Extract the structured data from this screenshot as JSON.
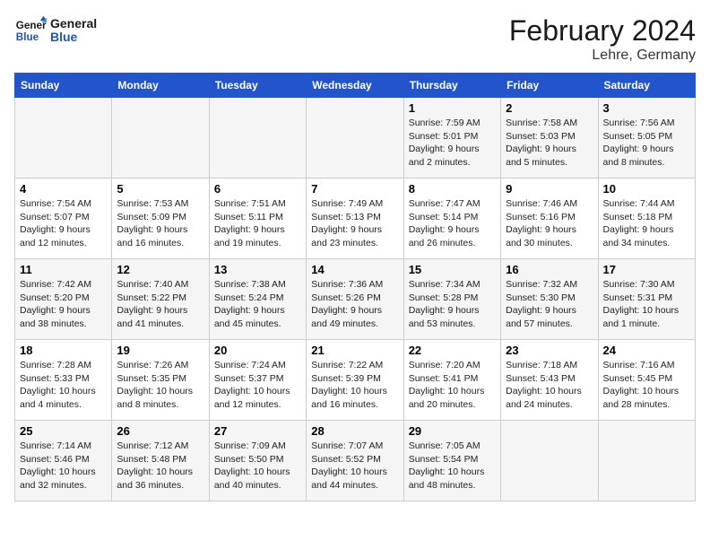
{
  "header": {
    "logo_general": "General",
    "logo_blue": "Blue",
    "title": "February 2024",
    "subtitle": "Lehre, Germany"
  },
  "weekdays": [
    "Sunday",
    "Monday",
    "Tuesday",
    "Wednesday",
    "Thursday",
    "Friday",
    "Saturday"
  ],
  "weeks": [
    [
      {
        "day": "",
        "info": ""
      },
      {
        "day": "",
        "info": ""
      },
      {
        "day": "",
        "info": ""
      },
      {
        "day": "",
        "info": ""
      },
      {
        "day": "1",
        "info": "Sunrise: 7:59 AM\nSunset: 5:01 PM\nDaylight: 9 hours and 2 minutes."
      },
      {
        "day": "2",
        "info": "Sunrise: 7:58 AM\nSunset: 5:03 PM\nDaylight: 9 hours and 5 minutes."
      },
      {
        "day": "3",
        "info": "Sunrise: 7:56 AM\nSunset: 5:05 PM\nDaylight: 9 hours and 8 minutes."
      }
    ],
    [
      {
        "day": "4",
        "info": "Sunrise: 7:54 AM\nSunset: 5:07 PM\nDaylight: 9 hours and 12 minutes."
      },
      {
        "day": "5",
        "info": "Sunrise: 7:53 AM\nSunset: 5:09 PM\nDaylight: 9 hours and 16 minutes."
      },
      {
        "day": "6",
        "info": "Sunrise: 7:51 AM\nSunset: 5:11 PM\nDaylight: 9 hours and 19 minutes."
      },
      {
        "day": "7",
        "info": "Sunrise: 7:49 AM\nSunset: 5:13 PM\nDaylight: 9 hours and 23 minutes."
      },
      {
        "day": "8",
        "info": "Sunrise: 7:47 AM\nSunset: 5:14 PM\nDaylight: 9 hours and 26 minutes."
      },
      {
        "day": "9",
        "info": "Sunrise: 7:46 AM\nSunset: 5:16 PM\nDaylight: 9 hours and 30 minutes."
      },
      {
        "day": "10",
        "info": "Sunrise: 7:44 AM\nSunset: 5:18 PM\nDaylight: 9 hours and 34 minutes."
      }
    ],
    [
      {
        "day": "11",
        "info": "Sunrise: 7:42 AM\nSunset: 5:20 PM\nDaylight: 9 hours and 38 minutes."
      },
      {
        "day": "12",
        "info": "Sunrise: 7:40 AM\nSunset: 5:22 PM\nDaylight: 9 hours and 41 minutes."
      },
      {
        "day": "13",
        "info": "Sunrise: 7:38 AM\nSunset: 5:24 PM\nDaylight: 9 hours and 45 minutes."
      },
      {
        "day": "14",
        "info": "Sunrise: 7:36 AM\nSunset: 5:26 PM\nDaylight: 9 hours and 49 minutes."
      },
      {
        "day": "15",
        "info": "Sunrise: 7:34 AM\nSunset: 5:28 PM\nDaylight: 9 hours and 53 minutes."
      },
      {
        "day": "16",
        "info": "Sunrise: 7:32 AM\nSunset: 5:30 PM\nDaylight: 9 hours and 57 minutes."
      },
      {
        "day": "17",
        "info": "Sunrise: 7:30 AM\nSunset: 5:31 PM\nDaylight: 10 hours and 1 minute."
      }
    ],
    [
      {
        "day": "18",
        "info": "Sunrise: 7:28 AM\nSunset: 5:33 PM\nDaylight: 10 hours and 4 minutes."
      },
      {
        "day": "19",
        "info": "Sunrise: 7:26 AM\nSunset: 5:35 PM\nDaylight: 10 hours and 8 minutes."
      },
      {
        "day": "20",
        "info": "Sunrise: 7:24 AM\nSunset: 5:37 PM\nDaylight: 10 hours and 12 minutes."
      },
      {
        "day": "21",
        "info": "Sunrise: 7:22 AM\nSunset: 5:39 PM\nDaylight: 10 hours and 16 minutes."
      },
      {
        "day": "22",
        "info": "Sunrise: 7:20 AM\nSunset: 5:41 PM\nDaylight: 10 hours and 20 minutes."
      },
      {
        "day": "23",
        "info": "Sunrise: 7:18 AM\nSunset: 5:43 PM\nDaylight: 10 hours and 24 minutes."
      },
      {
        "day": "24",
        "info": "Sunrise: 7:16 AM\nSunset: 5:45 PM\nDaylight: 10 hours and 28 minutes."
      }
    ],
    [
      {
        "day": "25",
        "info": "Sunrise: 7:14 AM\nSunset: 5:46 PM\nDaylight: 10 hours and 32 minutes."
      },
      {
        "day": "26",
        "info": "Sunrise: 7:12 AM\nSunset: 5:48 PM\nDaylight: 10 hours and 36 minutes."
      },
      {
        "day": "27",
        "info": "Sunrise: 7:09 AM\nSunset: 5:50 PM\nDaylight: 10 hours and 40 minutes."
      },
      {
        "day": "28",
        "info": "Sunrise: 7:07 AM\nSunset: 5:52 PM\nDaylight: 10 hours and 44 minutes."
      },
      {
        "day": "29",
        "info": "Sunrise: 7:05 AM\nSunset: 5:54 PM\nDaylight: 10 hours and 48 minutes."
      },
      {
        "day": "",
        "info": ""
      },
      {
        "day": "",
        "info": ""
      }
    ]
  ]
}
